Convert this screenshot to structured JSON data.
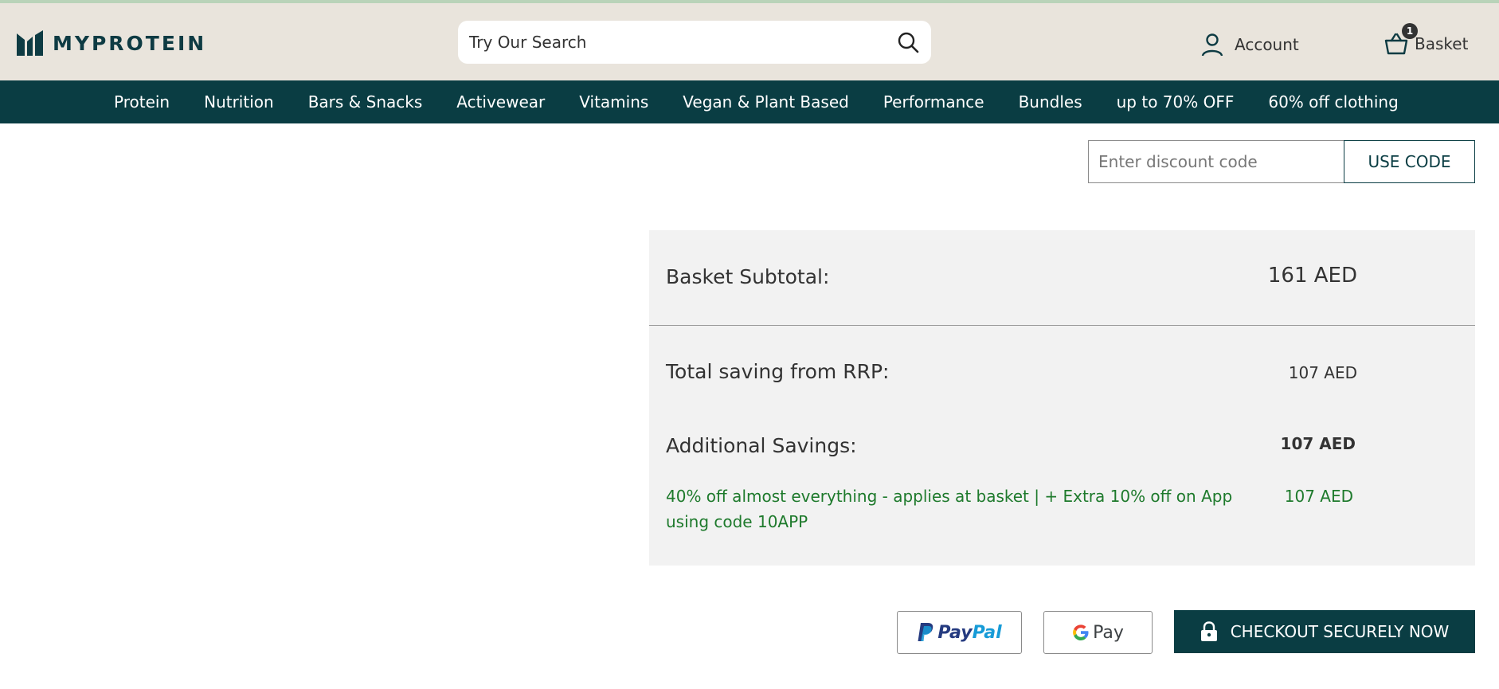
{
  "brand": {
    "name": "MYPROTEIN",
    "color": "#0e3b43"
  },
  "header": {
    "search_placeholder": "Try Our Search",
    "account_label": "Account",
    "basket_label": "Basket",
    "basket_count": "1"
  },
  "nav": {
    "items": [
      "Protein",
      "Nutrition",
      "Bars & Snacks",
      "Activewear",
      "Vitamins",
      "Vegan & Plant Based",
      "Performance",
      "Bundles",
      "up to 70% OFF",
      "60% off clothing"
    ]
  },
  "discount": {
    "placeholder": "Enter discount code",
    "button_label": "USE CODE"
  },
  "summary": {
    "subtotal_label": "Basket Subtotal:",
    "subtotal_value": "161 AED",
    "rrp_label": "Total saving from RRP:",
    "rrp_value": "107 AED",
    "additional_label": "Additional Savings:",
    "additional_value": "107 AED",
    "promo_text": "40% off almost everything - applies at basket | + Extra 10% off on App using code 10APP",
    "promo_value": "107 AED"
  },
  "payment": {
    "paypal_part1": "Pay",
    "paypal_part2": "Pal",
    "gpay_label": "Pay",
    "checkout_label": "CHECKOUT SECURELY NOW"
  },
  "colors": {
    "header_bg": "#e9e4dc",
    "nav_bg": "#0a3d43",
    "promo_green": "#1e7a2c",
    "summary_bg": "#f2f2f2"
  }
}
